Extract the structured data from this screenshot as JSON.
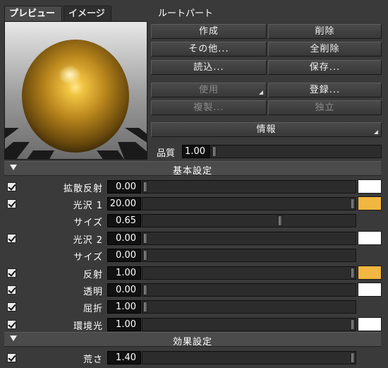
{
  "tabs": [
    {
      "label": "プレビュー",
      "active": true
    },
    {
      "label": "イメージ",
      "active": false
    }
  ],
  "root_part_label": "ルートパート",
  "buttons": {
    "create": "作成",
    "delete": "削除",
    "other": "その他...",
    "delete_all": "全削除",
    "load": "読込...",
    "save": "保存...",
    "use": "使用",
    "register": "登録...",
    "duplicate": "複製...",
    "independent": "独立",
    "info": "情報"
  },
  "quality": {
    "label": "品質",
    "value": "1.00",
    "level": 0.0
  },
  "sections": {
    "basic": "基本設定",
    "effect": "効果設定"
  },
  "params": [
    {
      "label": "拡散反射",
      "value": "0.00",
      "checked": true,
      "level": 0.0,
      "swatch": "#ffffff"
    },
    {
      "label": "光沢 1",
      "value": "20.00",
      "checked": true,
      "level": 1.0,
      "swatch": "#f2b740"
    },
    {
      "label": "サイズ",
      "value": "0.65",
      "checked": false,
      "level": 0.65,
      "swatch": null
    },
    {
      "label": "光沢 2",
      "value": "0.00",
      "checked": true,
      "level": 0.0,
      "swatch": "#ffffff"
    },
    {
      "label": "サイズ",
      "value": "0.00",
      "checked": false,
      "level": 0.0,
      "swatch": null
    },
    {
      "label": "反射",
      "value": "1.00",
      "checked": true,
      "level": 1.0,
      "swatch": "#f2b740"
    },
    {
      "label": "透明",
      "value": "0.00",
      "checked": true,
      "level": 0.0,
      "swatch": "#ffffff"
    },
    {
      "label": "屈折",
      "value": "1.00",
      "checked": true,
      "level": 0.0,
      "swatch": null
    },
    {
      "label": "環境光",
      "value": "1.00",
      "checked": true,
      "level": 1.0,
      "swatch": "#ffffff"
    }
  ],
  "effect_params": [
    {
      "label": "荒さ",
      "value": "1.40",
      "checked": true,
      "level": 1.0
    }
  ],
  "colors": {
    "accent_gold": "#f2b740",
    "sphere_gold": "#c8961e"
  }
}
